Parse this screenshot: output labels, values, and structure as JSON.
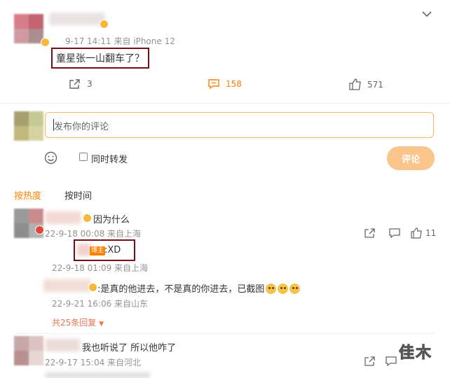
{
  "post": {
    "meta": "9-17 14:11 来自 iPhone 12",
    "text": "童星张一山翻车了？",
    "share_count": "3",
    "comment_count": "158",
    "like_count": "571"
  },
  "composer": {
    "placeholder": "发布你的评论",
    "repost_label": "同时转发",
    "submit_label": "评论"
  },
  "sort_tabs": {
    "hot": "按热度",
    "time": "按时间"
  },
  "comments": [
    {
      "text": "因为什么",
      "meta": "22-9-18 00:08 来自上海",
      "like_count": "11",
      "replies": [
        {
          "badge": "博主",
          "text": ":XD",
          "meta": "22-9-18 01:09 来自上海"
        },
        {
          "text": ":是真的他进去，不是真的你进去，已截图",
          "meta": "22-9-21 16:06 来自山东"
        }
      ],
      "more_replies": "共25条回复"
    },
    {
      "text": "我也听说了 所以他咋了",
      "meta": "22-9-17 15:04 来自河北"
    }
  ],
  "watermark": "佳木",
  "colors": {
    "accent": "#ff8200",
    "annotation_box": "#7a0e16",
    "submit_bg": "#fbc48a"
  }
}
